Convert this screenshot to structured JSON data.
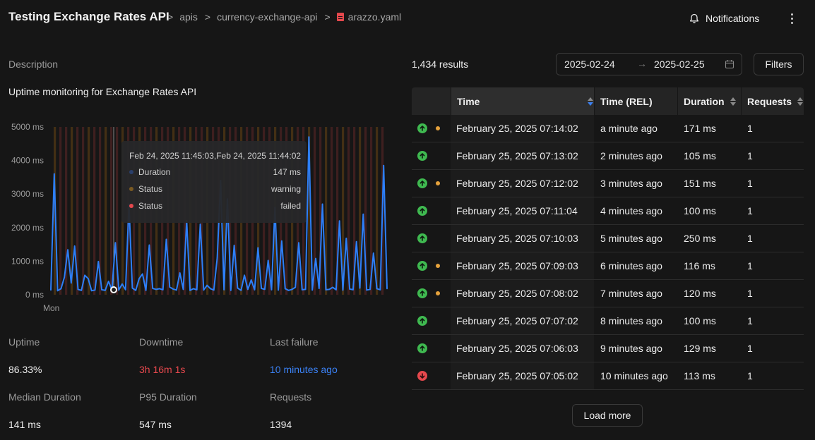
{
  "header": {
    "title": "Testing Exchange Rates API",
    "breadcrumb": [
      ">",
      "apis",
      ">",
      "currency-exchange-api",
      ">"
    ],
    "file_name": "arazzo.yaml",
    "notifications_label": "Notifications",
    "bell_icon": "bell-icon",
    "more_icon": "more-vertical-icon"
  },
  "description": {
    "label": "Description",
    "text": "Uptime monitoring for Exchange Rates API"
  },
  "chart_data": {
    "type": "line",
    "title": "",
    "xlabel": "",
    "ylabel": "",
    "y_tick_labels": [
      "5000 ms",
      "4000 ms",
      "3000 ms",
      "2000 ms",
      "1000 ms",
      "0 ms"
    ],
    "y_ticks": [
      5000,
      4000,
      3000,
      2000,
      1000,
      0
    ],
    "ylim": [
      0,
      5000
    ],
    "x_tick_labels": [
      "Mon"
    ],
    "grid": false,
    "series": [
      {
        "name": "Duration",
        "color": "#2d7ff9",
        "values": [
          140,
          3600,
          120,
          180,
          520,
          1340,
          350,
          1450,
          160,
          130,
          580,
          480,
          120,
          140,
          990,
          150,
          130,
          400,
          140,
          1550,
          140,
          320,
          150,
          2700,
          200,
          130,
          480,
          620,
          130,
          1480,
          190,
          160,
          180,
          150,
          1650,
          230,
          170,
          140,
          650,
          160,
          2200,
          130,
          180,
          150,
          2100,
          140,
          280,
          180,
          140,
          1100,
          3400,
          150,
          2850,
          130,
          1470,
          200,
          130,
          580,
          160,
          440,
          150,
          1400,
          190,
          160,
          1020,
          150,
          2600,
          140,
          1600,
          180,
          130,
          160,
          220,
          1550,
          150,
          160,
          4700,
          140,
          1080,
          190,
          2700,
          150,
          160,
          220,
          150,
          2200,
          140,
          1680,
          170,
          150,
          1580,
          200,
          2400,
          140,
          160,
          1240,
          180,
          150,
          3850,
          180
        ]
      }
    ],
    "status_bands": [
      {
        "name": "Status",
        "status": "warning",
        "color": "#7a4d12"
      },
      {
        "name": "Status",
        "status": "failed",
        "color": "#6e2a2a"
      }
    ],
    "tooltip": {
      "header": "Feb 24, 2025 11:45:03,Feb 24, 2025 11:44:02",
      "rows": [
        {
          "name": "Duration",
          "value": "147 ms",
          "color": "#2a3f6b"
        },
        {
          "name": "Status",
          "value": "warning",
          "color": "#7a5a22"
        },
        {
          "name": "Status",
          "value": "failed",
          "color": "#e5484d"
        }
      ]
    }
  },
  "stats": [
    {
      "label": "Uptime",
      "value": "86.33%",
      "color": "#ededed"
    },
    {
      "label": "Downtime",
      "value": "3h 16m 1s",
      "color": "#e5484d"
    },
    {
      "label": "Last failure",
      "value": "10 minutes ago",
      "color": "#3b82f6"
    },
    {
      "label": "Median Duration",
      "value": "141 ms",
      "color": "#ededed"
    },
    {
      "label": "P95 Duration",
      "value": "547 ms",
      "color": "#ededed"
    },
    {
      "label": "Requests",
      "value": "1394",
      "color": "#ededed"
    }
  ],
  "results": {
    "count_text": "1,434 results",
    "date_from": "2025-02-24",
    "date_to": "2025-02-25",
    "arrow": "→",
    "calendar_icon": "calendar-icon",
    "filters_label": "Filters"
  },
  "table": {
    "columns": [
      "Time",
      "Time (REL)",
      "Duration",
      "Requests"
    ],
    "rows": [
      {
        "status": "success",
        "warning": true,
        "time": "February 25, 2025 07:14:02",
        "rel": "a minute ago",
        "duration": "171 ms",
        "requests": "1"
      },
      {
        "status": "success",
        "warning": false,
        "time": "February 25, 2025 07:13:02",
        "rel": "2 minutes ago",
        "duration": "105 ms",
        "requests": "1"
      },
      {
        "status": "success",
        "warning": true,
        "time": "February 25, 2025 07:12:02",
        "rel": "3 minutes ago",
        "duration": "151 ms",
        "requests": "1"
      },
      {
        "status": "success",
        "warning": false,
        "time": "February 25, 2025 07:11:04",
        "rel": "4 minutes ago",
        "duration": "100 ms",
        "requests": "1"
      },
      {
        "status": "success",
        "warning": false,
        "time": "February 25, 2025 07:10:03",
        "rel": "5 minutes ago",
        "duration": "250 ms",
        "requests": "1"
      },
      {
        "status": "success",
        "warning": true,
        "time": "February 25, 2025 07:09:03",
        "rel": "6 minutes ago",
        "duration": "116 ms",
        "requests": "1"
      },
      {
        "status": "success",
        "warning": true,
        "time": "February 25, 2025 07:08:02",
        "rel": "7 minutes ago",
        "duration": "120 ms",
        "requests": "1"
      },
      {
        "status": "success",
        "warning": false,
        "time": "February 25, 2025 07:07:02",
        "rel": "8 minutes ago",
        "duration": "100 ms",
        "requests": "1"
      },
      {
        "status": "success",
        "warning": false,
        "time": "February 25, 2025 07:06:03",
        "rel": "9 minutes ago",
        "duration": "129 ms",
        "requests": "1"
      },
      {
        "status": "failed",
        "warning": false,
        "time": "February 25, 2025 07:05:02",
        "rel": "10 minutes ago",
        "duration": "113 ms",
        "requests": "1"
      }
    ],
    "load_more_label": "Load more"
  }
}
